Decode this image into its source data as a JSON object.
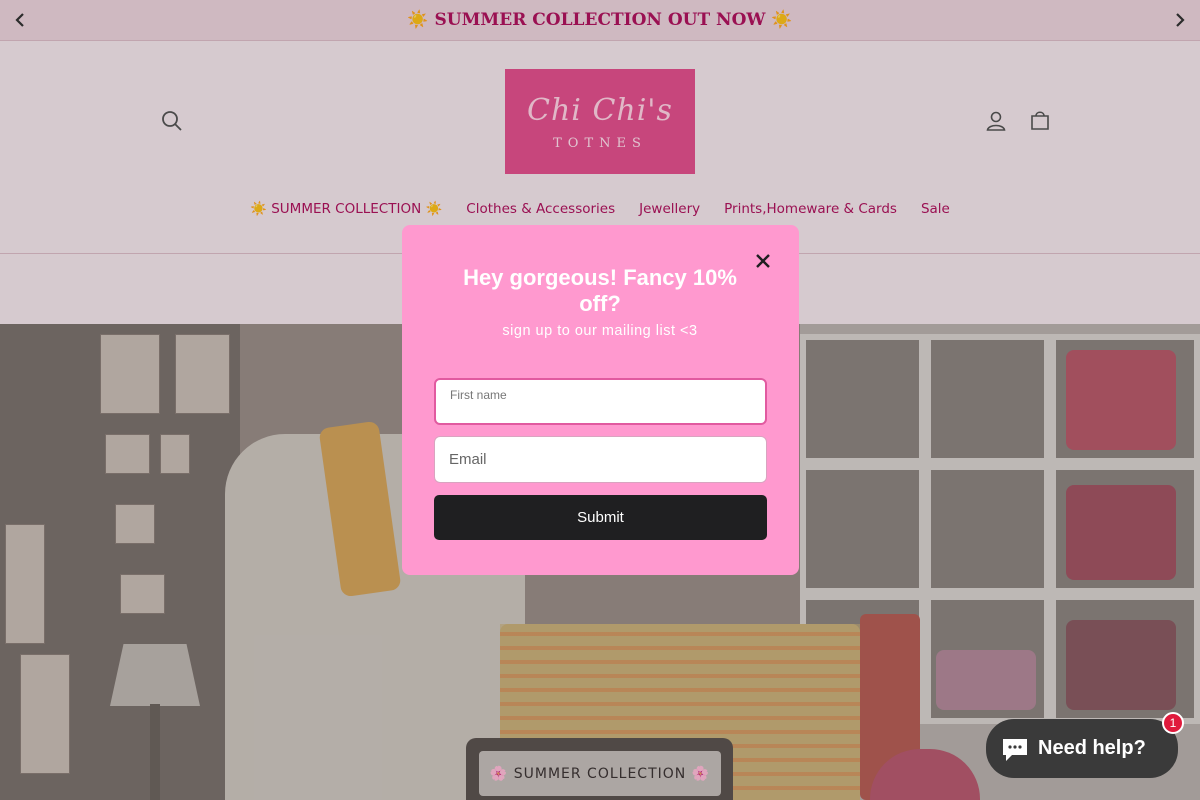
{
  "announcement": {
    "text": "☀️ SUMMER COLLECTION OUT NOW ☀️",
    "prev_icon": "chevron-left-icon",
    "next_icon": "chevron-right-icon"
  },
  "header": {
    "logo": {
      "script": "Chi Chi's",
      "subtitle": "TOTNES"
    },
    "icons": {
      "search": "search-icon",
      "account": "user-icon",
      "cart": "bag-icon"
    }
  },
  "nav": {
    "items": [
      {
        "label": "☀️ SUMMER COLLECTION ☀️"
      },
      {
        "label": "Clothes & Accessories"
      },
      {
        "label": "Jewellery"
      },
      {
        "label": "Prints,Homeware & Cards"
      },
      {
        "label": "Sale"
      }
    ]
  },
  "hero": {
    "button_label": "🌸 SUMMER COLLECTION 🌸"
  },
  "popup": {
    "title": "Hey gorgeous! Fancy 10% off?",
    "subtitle": "sign up to our mailing list <3",
    "first_name_label": "First name",
    "first_name_value": "",
    "email_placeholder": "Email",
    "email_value": "",
    "submit_label": "Submit",
    "close_icon": "close-icon"
  },
  "chat": {
    "label": "Need help?",
    "badge_count": "1",
    "icon": "chat-bubble-icon"
  },
  "colors": {
    "brand_pink": "#b0135e",
    "logo_pink": "#e3508e",
    "popup_pink": "#ff99cf",
    "submit_dark": "#1f1f21"
  }
}
